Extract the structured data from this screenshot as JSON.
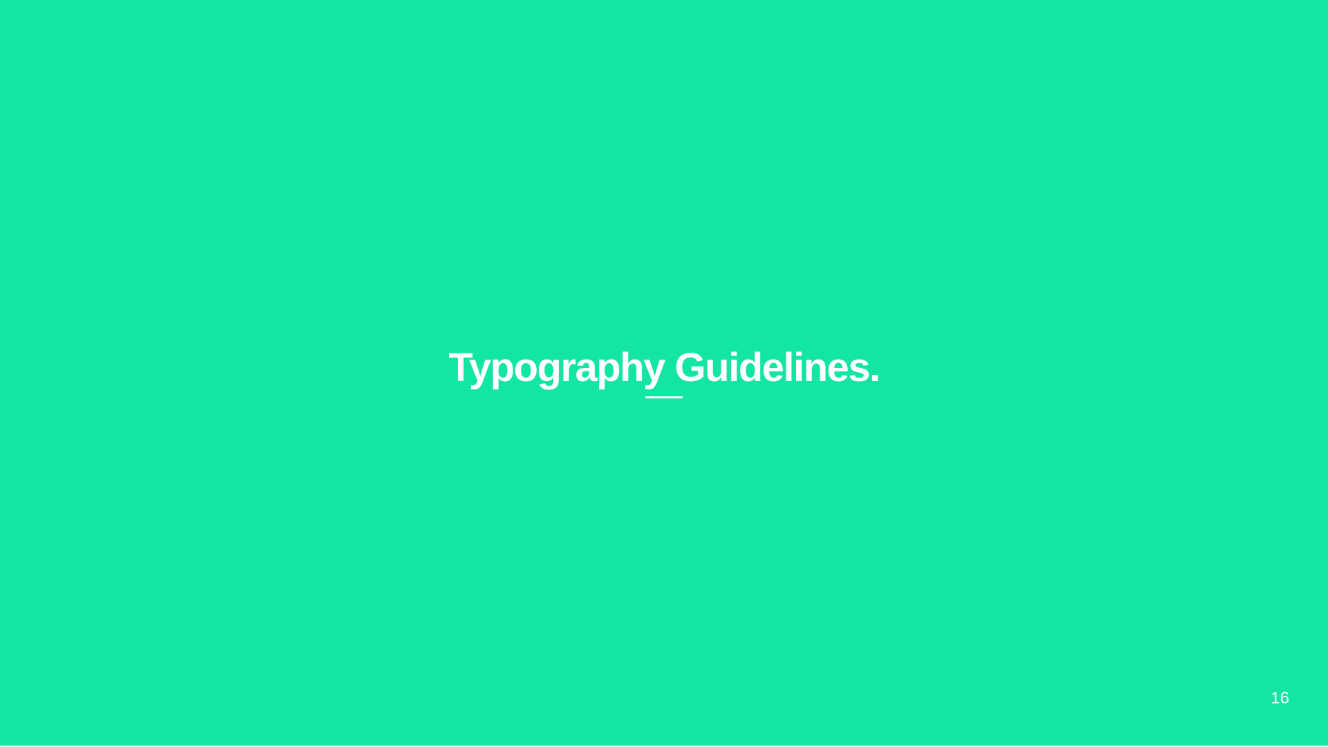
{
  "slide": {
    "title": "Typography Guidelines.",
    "page_number": "16"
  },
  "colors": {
    "background": "#13E5A3",
    "text": "#FFFFFF"
  }
}
